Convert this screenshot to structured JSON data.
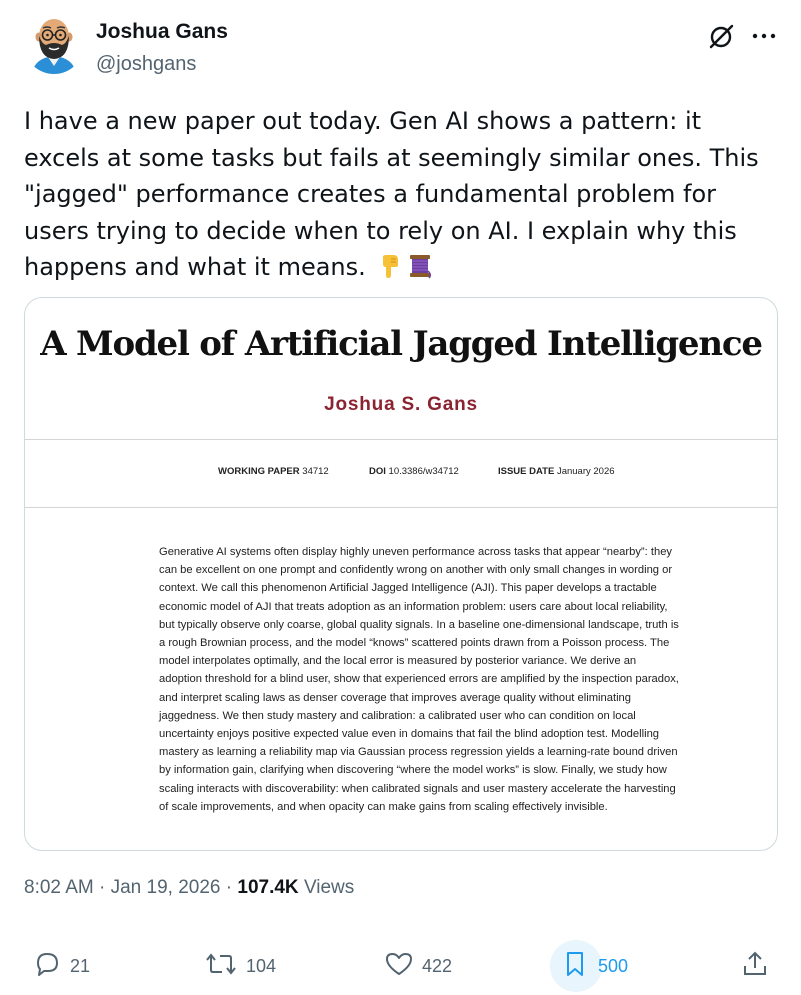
{
  "author": {
    "name": "Joshua Gans",
    "handle": "@joshgans",
    "avatar_icon": "bald-bearded-man-glasses-avatar"
  },
  "header_icons": [
    "grok-icon",
    "more-options-icon"
  ],
  "tweet": {
    "text": "I have a new paper out today. Gen AI shows a pattern: it excels at some tasks but fails at seemingly similar ones. This \"jagged\" performance creates a fundamental problem for users trying to decide when to rely on AI. I explain why this happens and what it means.",
    "emojis": [
      "backhand-index-pointing-down",
      "spool-of-thread"
    ]
  },
  "paper": {
    "title": "A Model of Artificial Jagged Intelligence",
    "author": "Joshua S. Gans",
    "working_paper_label": "WORKING PAPER",
    "working_paper_value": "34712",
    "doi_label": "DOI",
    "doi_value": "10.3386/w34712",
    "issue_label": "ISSUE DATE",
    "issue_value": "January 2026",
    "abstract": "Generative AI systems often display highly uneven performance across tasks that appear “nearby”: they can be excellent on one prompt and confidently wrong on another with only small changes in wording or context. We call this phenomenon Artificial Jagged Intelligence (AJI). This paper develops a tractable economic model of AJI that treats adoption as an information problem: users care about local reliability, but typically observe only coarse, global quality signals. In a baseline one-dimensional landscape, truth is a rough Brownian process, and the model “knows” scattered points drawn from a Poisson process. The model interpolates optimally, and the local error is measured by posterior variance. We derive an adoption threshold for a blind user, show that experienced errors are amplified by the inspection paradox, and interpret scaling laws as denser coverage that improves average quality without eliminating jaggedness. We then study mastery and calibration: a calibrated user who can condition on local uncertainty enjoys positive expected value even in domains that fail the blind adoption test. Modelling mastery as learning a reliability map via Gaussian process regression yields a learning-rate bound driven by information gain, clarifying when discovering “where the model works” is slow. Finally, we study how scaling interacts with discoverability: when calibrated signals and user mastery accelerate the harvesting of scale improvements, and when opacity can make gains from scaling effectively invisible."
  },
  "meta": {
    "time": "8:02 AM",
    "separator": "·",
    "date": "Jan 19, 2026",
    "views_count": "107.4K",
    "views_label": "Views"
  },
  "actions": {
    "replies": "21",
    "reposts": "104",
    "likes": "422",
    "bookmarks": "500"
  },
  "colors": {
    "text": "#0f1419",
    "secondary": "#536471",
    "accent": "#1d9bf0",
    "paper_author": "#8b2330",
    "border": "#cfd9de"
  }
}
